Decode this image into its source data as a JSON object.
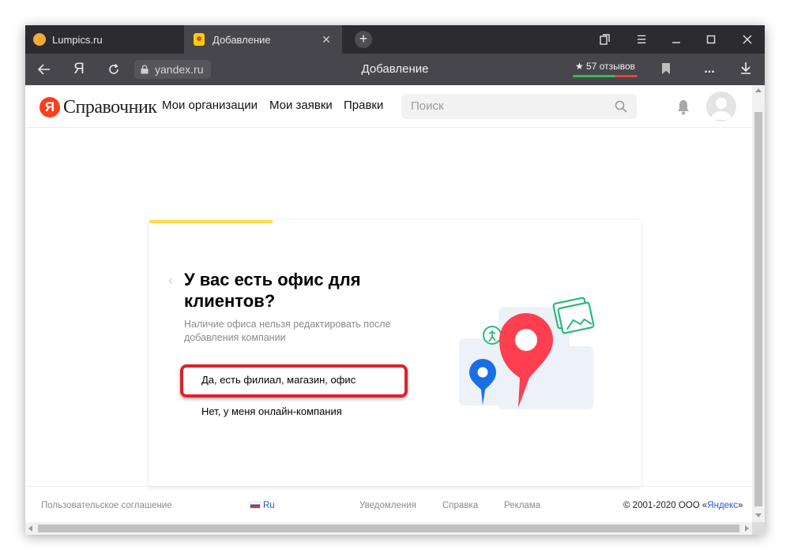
{
  "browser": {
    "tabs": [
      {
        "title": "Lumpics.ru",
        "favicon": "orange-circle-icon"
      },
      {
        "title": "Добавление",
        "favicon": "yandex-sprav-icon"
      }
    ],
    "address": {
      "domain": "yandex.ru",
      "page_title": "Добавление",
      "yandex_glyph": "Я",
      "reviews_label": "★ 57 отзывов"
    }
  },
  "site": {
    "logo_letter": "Я",
    "logo_text": "Справочник",
    "nav": [
      "Мои организации",
      "Мои заявки",
      "Правки"
    ],
    "search_placeholder": "Поиск"
  },
  "card": {
    "progress": 0.25,
    "title": "У вас есть офис для клиентов?",
    "subtitle": "Наличие офиса нельзя редактировать после добавления компании",
    "options": [
      "Да, есть филиал, магазин, офис",
      "Нет, у меня онлайн-компания"
    ]
  },
  "footer": {
    "agreement": "Пользовательское соглашение",
    "lang": "Ru",
    "notifications": "Уведомления",
    "help": "Справка",
    "ads": "Реклама",
    "copyright_prefix": "© 2001-2020 ООО «",
    "copyright_link": "Яндекс",
    "copyright_suffix": "»"
  },
  "colors": {
    "accent_yellow": "#ffdb4d",
    "highlight_red": "#d9232d",
    "yandex_red": "#fc3f1d",
    "pin_red": "#ff3f4f",
    "pin_blue": "#1a6fe6",
    "illus_green": "#2db87e"
  }
}
